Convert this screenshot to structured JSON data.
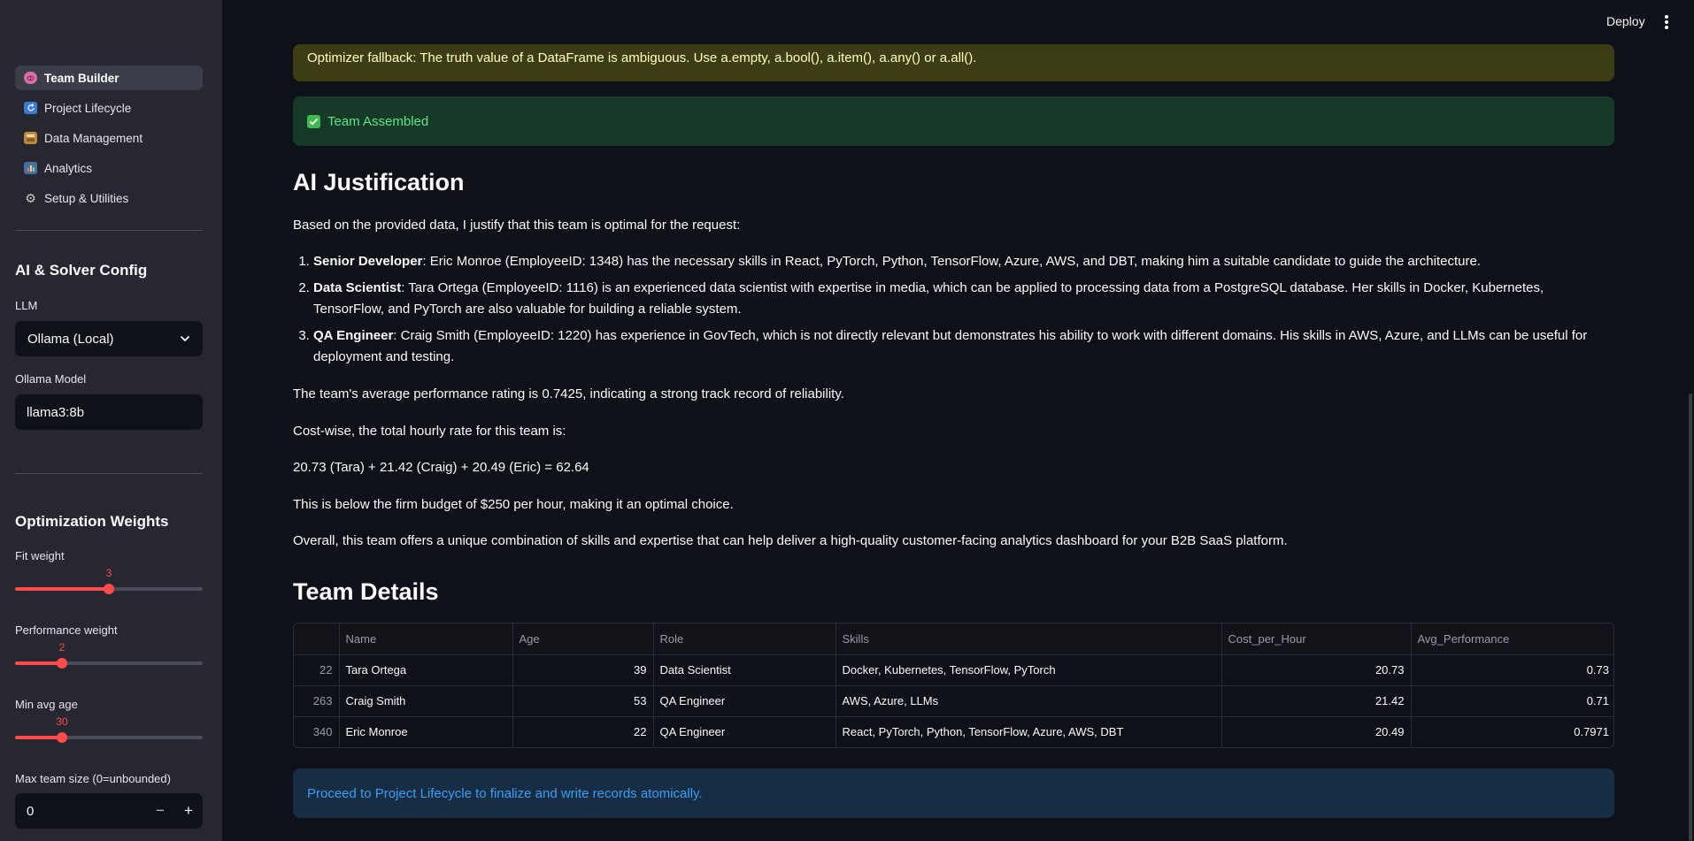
{
  "header": {
    "deploy_label": "Deploy"
  },
  "sidebar": {
    "nav": [
      {
        "label": "Team Builder",
        "icon": "brain-icon",
        "active": true
      },
      {
        "label": "Project Lifecycle",
        "icon": "cycle-icon",
        "active": false
      },
      {
        "label": "Data Management",
        "icon": "database-icon",
        "active": false
      },
      {
        "label": "Analytics",
        "icon": "bar-chart-icon",
        "active": false
      },
      {
        "label": "Setup & Utilities",
        "icon": "gear-icon",
        "active": false
      }
    ],
    "ai_config": {
      "heading": "AI & Solver Config",
      "llm_label": "LLM",
      "llm_value": "Ollama (Local)",
      "model_label": "Ollama Model",
      "model_value": "llama3:8b"
    },
    "weights": {
      "heading": "Optimization Weights",
      "fit": {
        "label": "Fit weight",
        "value": "3",
        "fraction": 0.5
      },
      "performance": {
        "label": "Performance weight",
        "value": "2",
        "fraction": 0.25
      },
      "min_age": {
        "label": "Min avg age",
        "value": "30",
        "fraction": 0.25
      },
      "max_team": {
        "label": "Max team size (0=unbounded)",
        "value": "0",
        "minus": "−",
        "plus": "+"
      }
    }
  },
  "main": {
    "warning": "Optimizer fallback: The truth value of a DataFrame is ambiguous. Use a.empty, a.bool(), a.item(), a.any() or a.all().",
    "success": "Team Assembled",
    "justification": {
      "title": "AI Justification",
      "intro": "Based on the provided data, I justify that this team is optimal for the request:",
      "items": [
        {
          "role": "Senior Developer",
          "text": ": Eric Monroe (EmployeeID: 1348) has the necessary skills in React, PyTorch, Python, TensorFlow, Azure, AWS, and DBT, making him a suitable candidate to guide the architecture."
        },
        {
          "role": "Data Scientist",
          "text": ": Tara Ortega (EmployeeID: 1116) is an experienced data scientist with expertise in media, which can be applied to processing data from a PostgreSQL database. Her skills in Docker, Kubernetes, TensorFlow, and PyTorch are also valuable for building a reliable system."
        },
        {
          "role": "QA Engineer",
          "text": ": Craig Smith (EmployeeID: 1220) has experience in GovTech, which is not directly relevant but demonstrates his ability to work with different domains. His skills in AWS, Azure, and LLMs can be useful for deployment and testing."
        }
      ],
      "p_avg": "The team's average performance rating is 0.7425, indicating a strong track record of reliability.",
      "p_cost": "Cost-wise, the total hourly rate for this team is:",
      "p_sum": "20.73 (Tara) + 21.42 (Craig) + 20.49 (Eric) = 62.64",
      "p_budget": "This is below the firm budget of $250 per hour, making it an optimal choice.",
      "p_overall": "Overall, this team offers a unique combination of skills and expertise that can help deliver a high-quality customer-facing analytics dashboard for your B2B SaaS platform."
    },
    "team": {
      "title": "Team Details",
      "columns": [
        "",
        "Name",
        "Age",
        "Role",
        "Skills",
        "Cost_per_Hour",
        "Avg_Performance"
      ],
      "rows": [
        [
          "22",
          "Tara Ortega",
          "39",
          "Data Scientist",
          "Docker, Kubernetes, TensorFlow, PyTorch",
          "20.73",
          "0.73"
        ],
        [
          "263",
          "Craig Smith",
          "53",
          "QA Engineer",
          "AWS, Azure, LLMs",
          "21.42",
          "0.71"
        ],
        [
          "340",
          "Eric Monroe",
          "22",
          "QA Engineer",
          "React, PyTorch, Python, TensorFlow, Azure, AWS, DBT",
          "20.49",
          "0.7971"
        ]
      ]
    },
    "info": "Proceed to Project Lifecycle to finalize and write records atomically."
  }
}
